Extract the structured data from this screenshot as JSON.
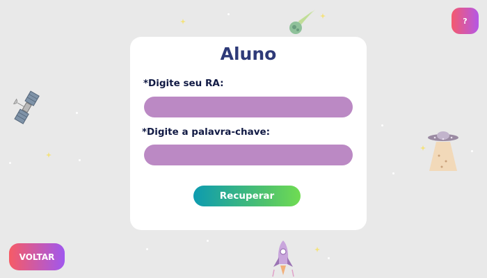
{
  "header": {
    "help_label": "?"
  },
  "card": {
    "title": "Aluno",
    "ra_label": "*Digite seu RA:",
    "ra_value": "",
    "keyword_label": "*Digite a palavra-chave:",
    "keyword_value": "",
    "submit_label": "Recuperar"
  },
  "footer": {
    "back_label": "VOLTAR"
  },
  "colors": {
    "background": "#e9e9e9",
    "title": "#2e3a78",
    "input_fill": "#bb89c4",
    "submit_start": "#0d9bb0",
    "submit_end": "#70dc52",
    "pink_purple_start": "#f45a6e",
    "pink_purple_end": "#b457e6"
  },
  "icons": [
    "satellite-icon",
    "comet-icon",
    "ufo-icon",
    "rocket-icon",
    "star-icon"
  ]
}
